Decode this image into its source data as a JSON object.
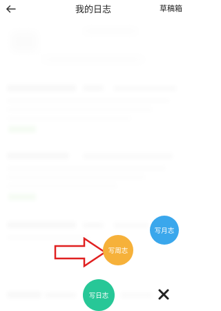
{
  "header": {
    "back_icon": "arrow-left-icon",
    "title": "我的日志",
    "drafts_label": "草稿箱"
  },
  "fab_menu": {
    "month_label": "写月志",
    "week_label": "写周志",
    "day_label": "写日志",
    "close_icon": "close-icon"
  },
  "colors": {
    "month": "#3aa7ec",
    "week": "#f6b13a",
    "day": "#27c797",
    "arrow": "#e02020"
  }
}
